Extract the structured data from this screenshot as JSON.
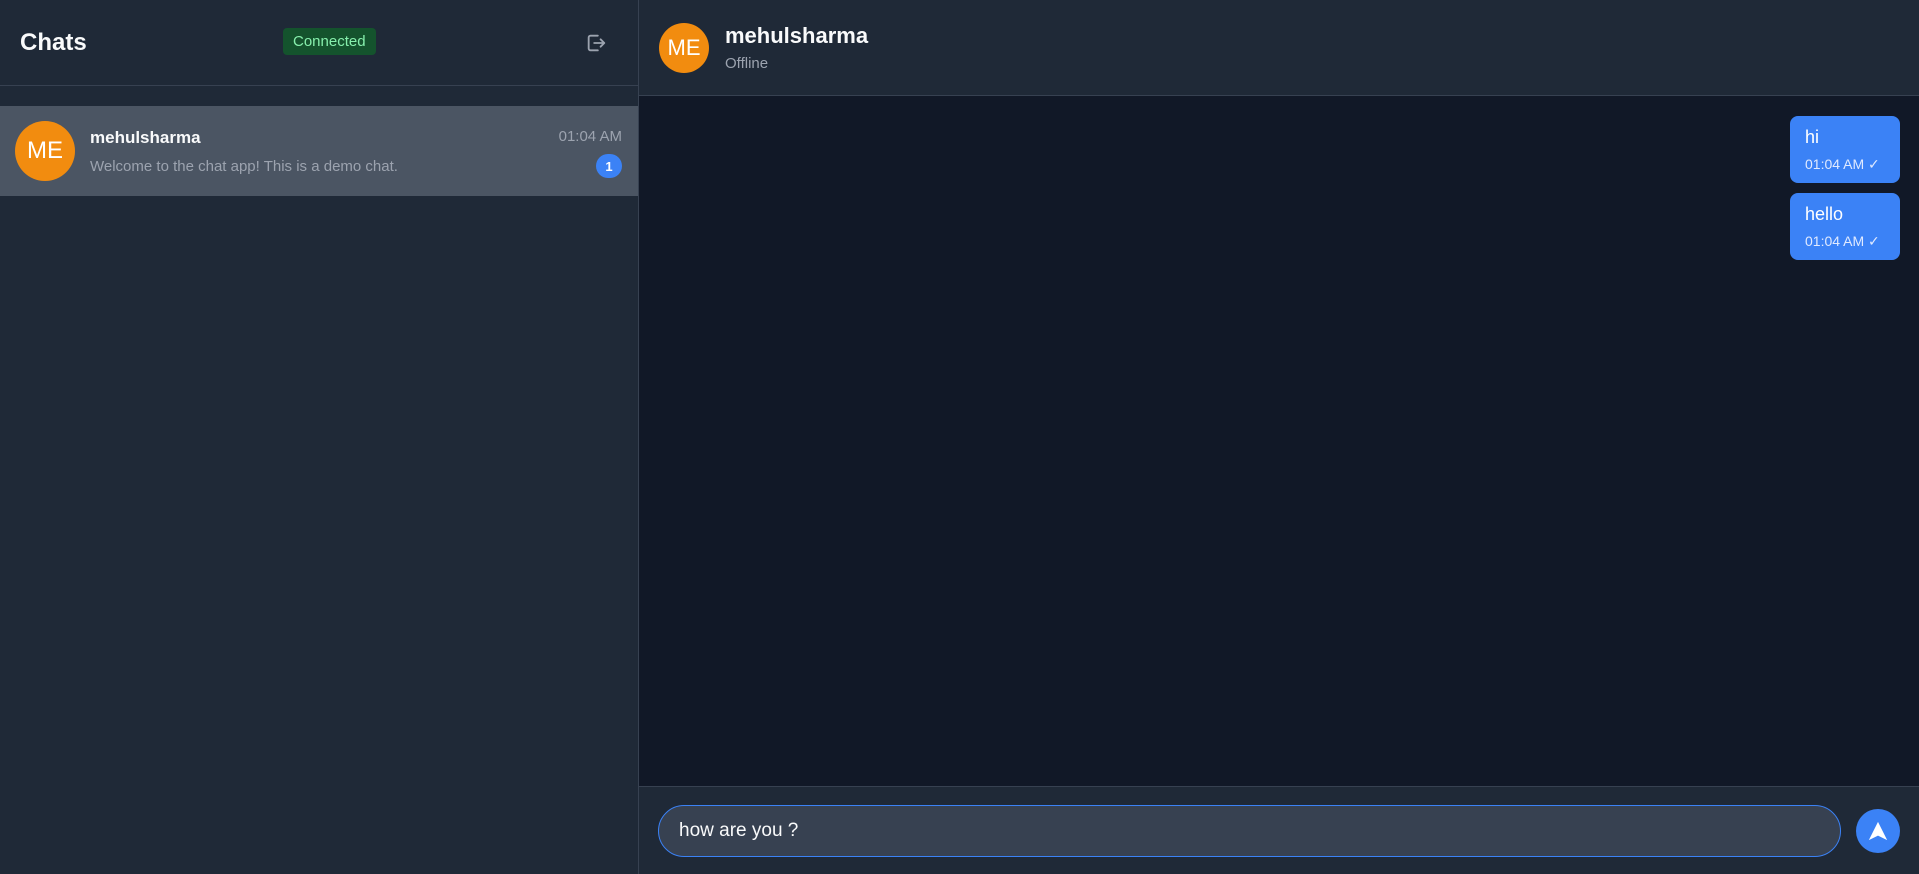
{
  "sidebar": {
    "title": "Chats",
    "connection_status": "Connected",
    "logout_icon": "logout-icon",
    "chats": [
      {
        "initials": "ME",
        "name": "mehulsharma",
        "preview": "Welcome to the chat app! This is a demo chat.",
        "time": "01:04 AM",
        "unread": "1"
      }
    ]
  },
  "conversation": {
    "contact": {
      "initials": "ME",
      "name": "mehulsharma",
      "status": "Offline"
    },
    "messages": [
      {
        "text": "hi",
        "meta": "01:04 AM ✓"
      },
      {
        "text": "hello",
        "meta": "01:04 AM ✓"
      }
    ],
    "composer": {
      "value": "how are you ?",
      "send_icon": "send-icon"
    }
  },
  "colors": {
    "accent": "#3b82f6",
    "avatar": "#f28c0f",
    "connected_bg": "#14532d",
    "connected_text": "#86efac"
  }
}
